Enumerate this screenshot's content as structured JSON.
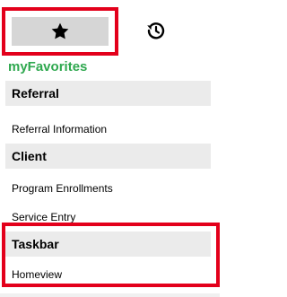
{
  "tabs": {
    "favorites": {
      "icon": "star-icon",
      "highlight_color": "#e3001b"
    },
    "history": {
      "icon": "history-icon"
    }
  },
  "section_title": "myFavorites",
  "groups": [
    {
      "label": "Referral",
      "items": [
        "Referral Information"
      ]
    },
    {
      "label": "Client",
      "items": [
        "Program Enrollments",
        "Service Entry"
      ]
    },
    {
      "label": "Taskbar",
      "items": [
        "Homeview"
      ]
    }
  ],
  "colors": {
    "accent_green": "#2fa84f",
    "highlight_red": "#e3001b",
    "header_bg": "#ebebeb",
    "active_tab_bg": "#d6d6d6"
  }
}
